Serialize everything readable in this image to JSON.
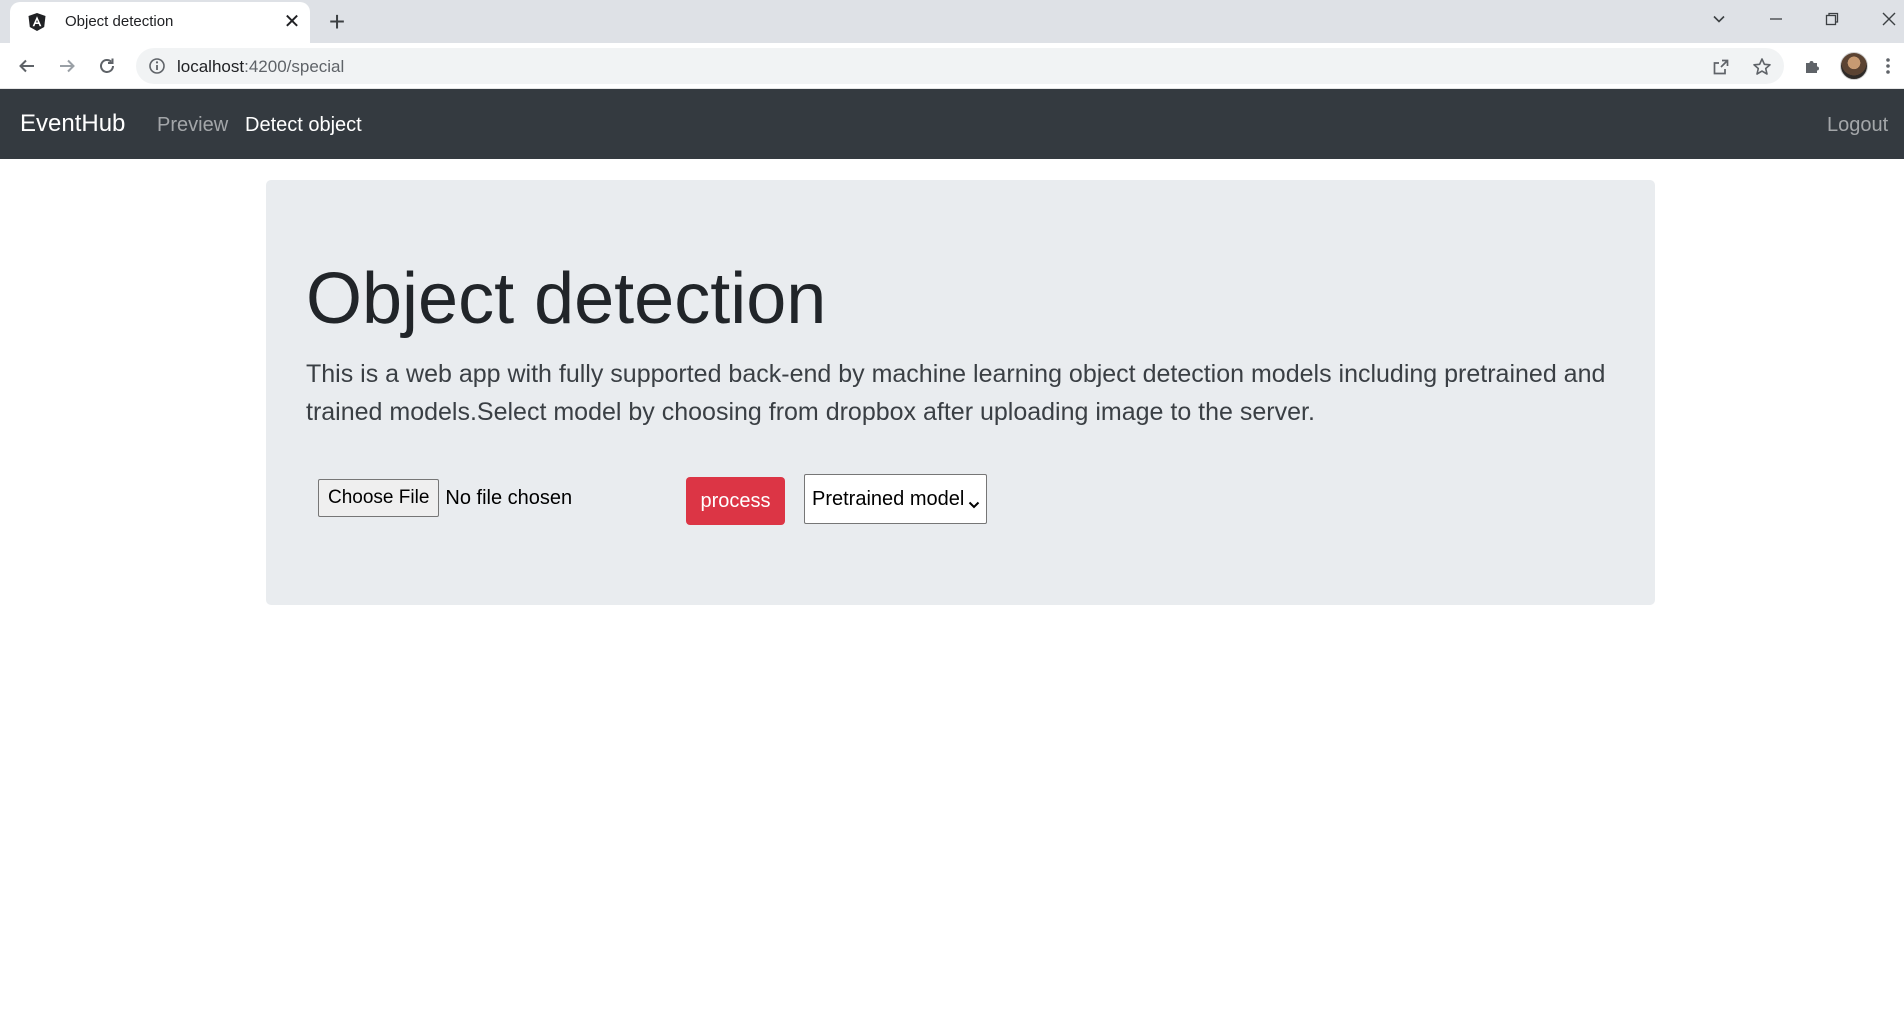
{
  "browser": {
    "tab_title": "Object detection",
    "tab_close_glyph": "✕",
    "new_tab_glyph": "+",
    "url_host": "localhost",
    "url_rest": ":4200/special",
    "icons": [
      "angular-favicon-icon",
      "back-icon",
      "forward-icon",
      "reload-icon",
      "info-icon",
      "share-icon",
      "star-icon",
      "extensions-icon",
      "kebab-menu-icon",
      "tab-search-icon",
      "minimize-icon",
      "restore-icon",
      "close-window-icon"
    ]
  },
  "navbar": {
    "brand": "EventHub",
    "links": [
      {
        "label": "Preview",
        "state": "inactive"
      },
      {
        "label": "Detect object",
        "state": "active"
      }
    ],
    "logout_label": "Logout",
    "background": "#343a40"
  },
  "main": {
    "title": "Object detection",
    "description": "This is a web app with fully supported back-end by machine learning object detection models including pretrained and trained models.Select model by choosing from dropbox after uploading image to the server.",
    "file_input": {
      "button_label": "Choose File",
      "status": "No file chosen"
    },
    "process_label": "process",
    "process_color": "#dc3545",
    "model_select": {
      "selected": "Pretrained model"
    }
  }
}
